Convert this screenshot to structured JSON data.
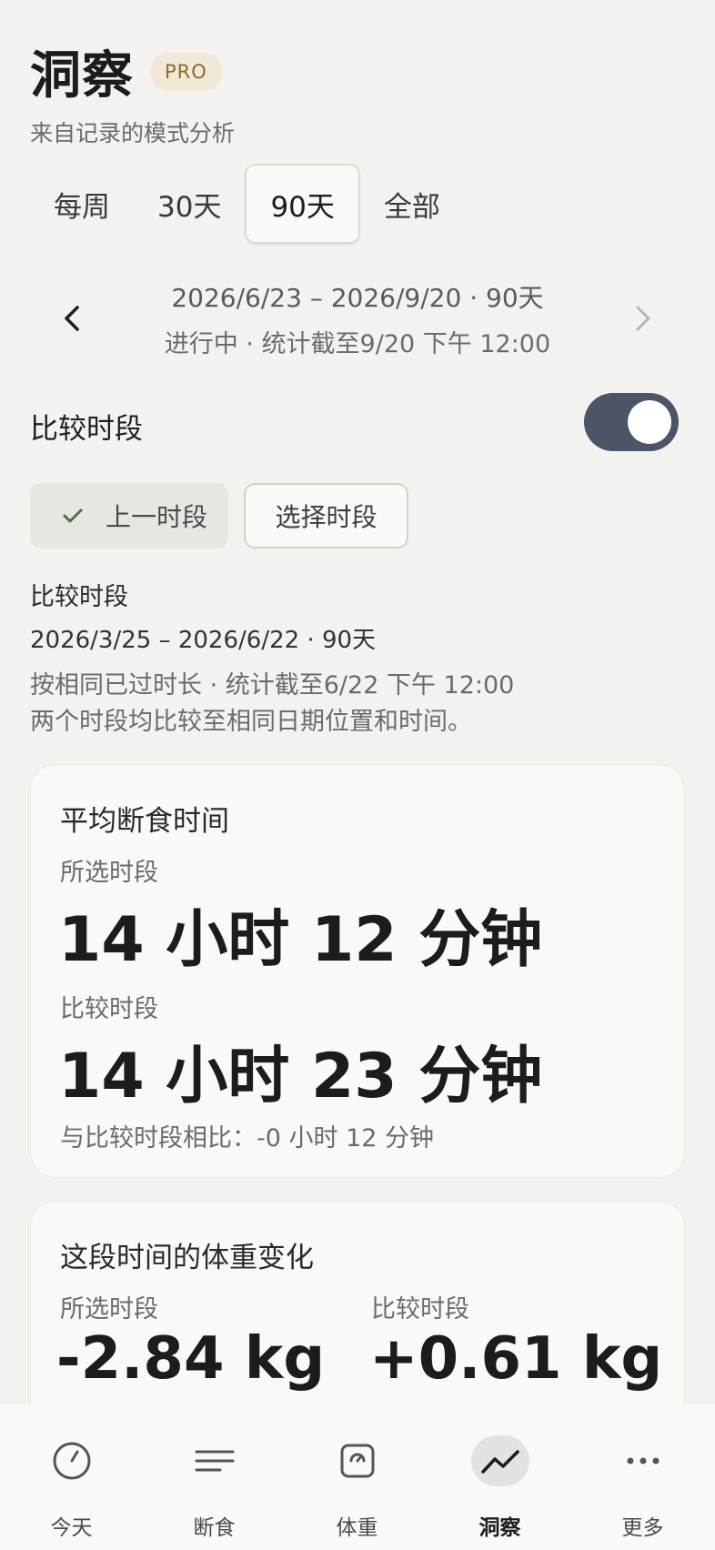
{
  "header": {
    "title": "洞察",
    "badge": "PRO",
    "subtitle": "来自记录的模式分析"
  },
  "range_tabs": [
    {
      "label": "每周",
      "active": false
    },
    {
      "label": "30天",
      "active": false
    },
    {
      "label": "90天",
      "active": true
    },
    {
      "label": "全部",
      "active": false
    }
  ],
  "period": {
    "range": "2026/6/23 – 2026/9/20 · 90天",
    "status": "进行中 · 统计截至9/20 下午 12:00",
    "prev_icon": "chevron-left-icon",
    "next_icon": "chevron-right-icon"
  },
  "compare": {
    "label": "比较时段",
    "toggle_on": true,
    "chip_prev": "上一时段",
    "chip_select": "选择时段",
    "info_title": "比较时段",
    "info_range": "2026/3/25 – 2026/6/22 · 90天",
    "info_note1": "按相同已过时长 · 统计截至6/22 下午 12:00",
    "info_note2": "两个时段均比较至相同日期位置和时间。"
  },
  "fasting_card": {
    "title": "平均断食时间",
    "selected_label": "所选时段",
    "selected_value": "14 小时 12 分钟",
    "compare_label": "比较时段",
    "compare_value": "14 小时 23 分钟",
    "diff": "与比较时段相比：-0 小时 12 分钟"
  },
  "weight_card": {
    "title": "这段时间的体重变化",
    "selected_label": "所选时段",
    "selected_value": "-2.84 kg",
    "compare_label": "比较时段",
    "compare_value": "+0.61 kg"
  },
  "bottom_nav": [
    {
      "label": "今天",
      "icon": "clock-icon",
      "active": false
    },
    {
      "label": "断食",
      "icon": "lines-icon",
      "active": false
    },
    {
      "label": "体重",
      "icon": "scale-icon",
      "active": false
    },
    {
      "label": "洞察",
      "icon": "trend-icon",
      "active": true
    },
    {
      "label": "更多",
      "icon": "more-icon",
      "active": false
    }
  ],
  "colors": {
    "accent": "#4b5567",
    "background": "#f4f2ef",
    "card": "#faf9f6",
    "badge_bg": "#f1e8d8",
    "badge_text": "#8b6a33"
  }
}
